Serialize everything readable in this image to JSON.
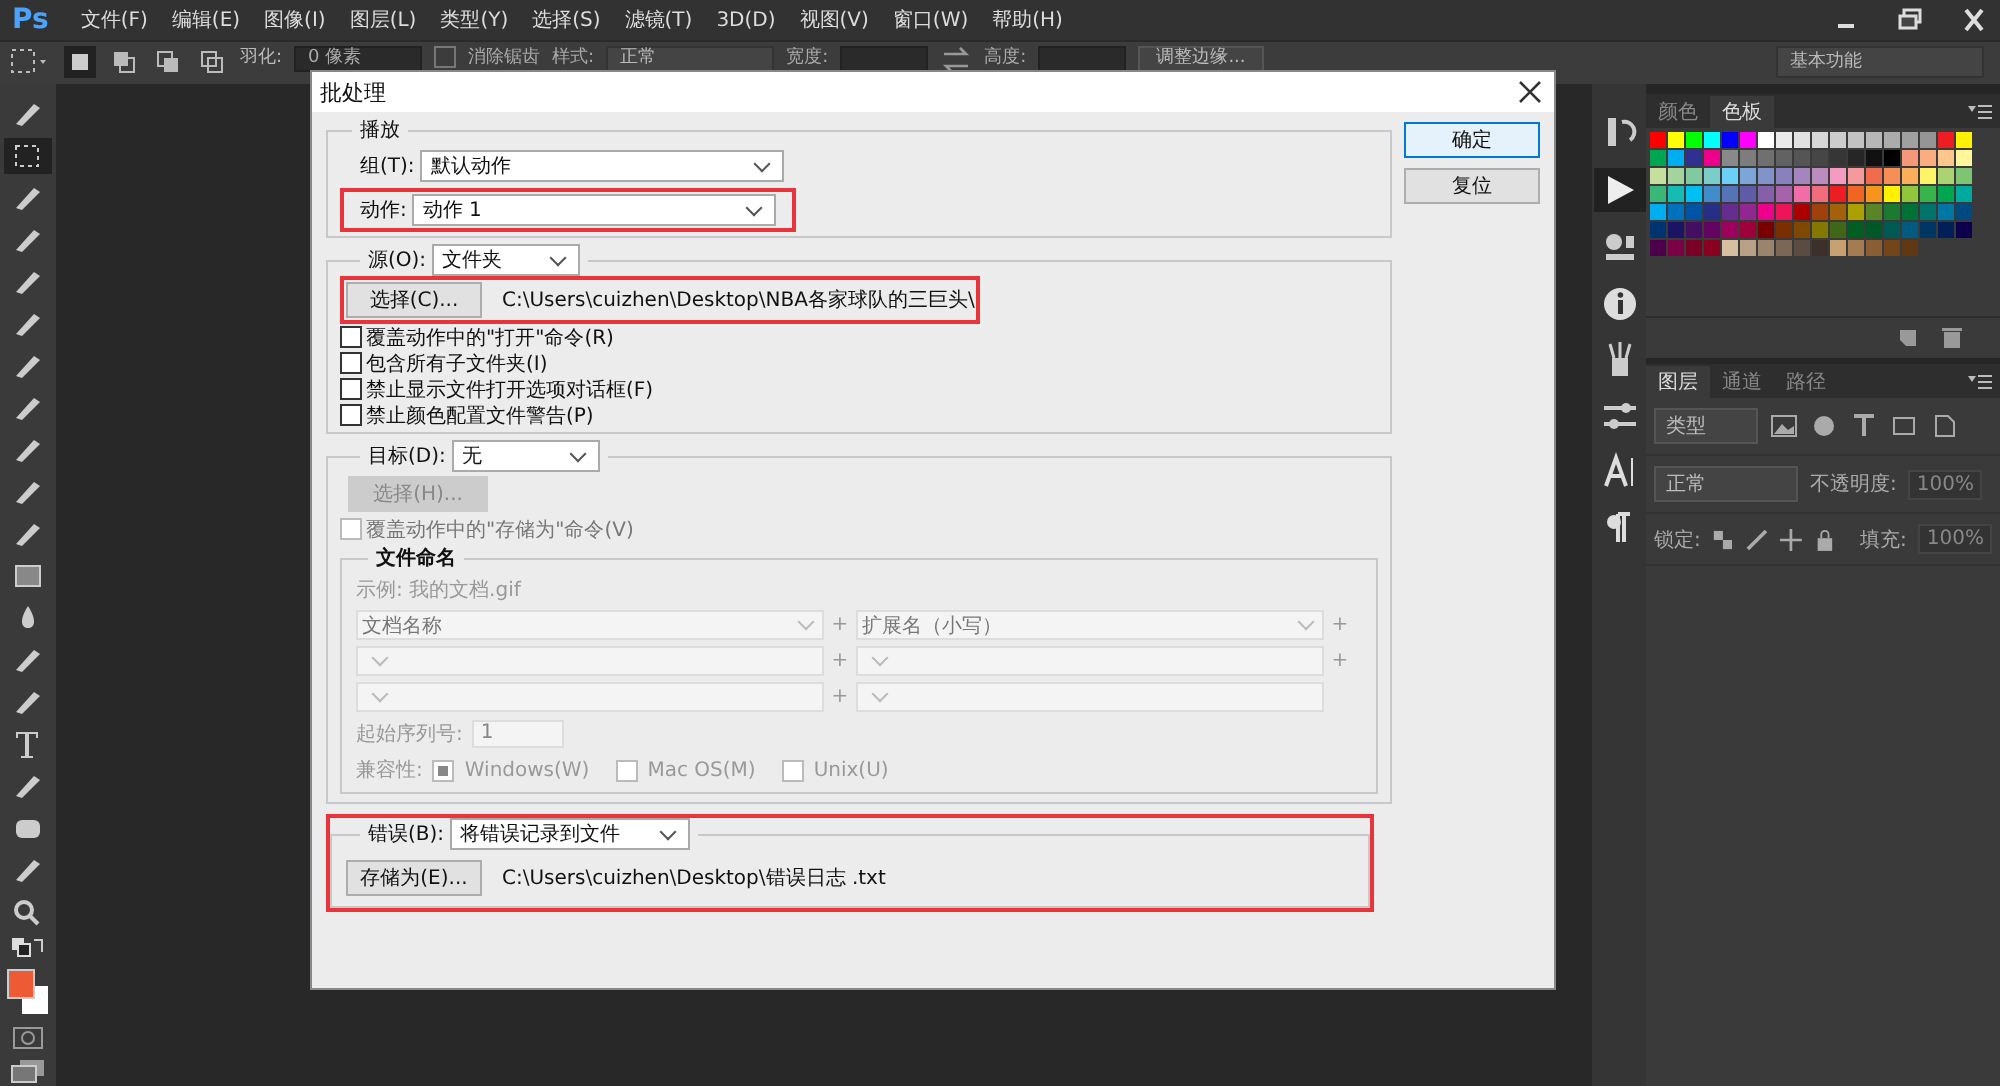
{
  "app": {
    "logo": "Ps",
    "menus": [
      "文件(F)",
      "编辑(E)",
      "图像(I)",
      "图层(L)",
      "类型(Y)",
      "选择(S)",
      "滤镜(T)",
      "3D(D)",
      "视图(V)",
      "窗口(W)",
      "帮助(H)"
    ]
  },
  "options_bar": {
    "feather_label": "羽化:",
    "feather_value": "0 像素",
    "antialias": {
      "label": "消除锯齿",
      "checked": false,
      "disabled": true
    },
    "style_label": "样式:",
    "style_value": "正常",
    "width_label": "宽度:",
    "height_label": "高度:",
    "refine_button": "调整边缘...",
    "workspace": "基本功能"
  },
  "dialog": {
    "title": "批处理",
    "buttons": [
      {
        "label": "确定",
        "default": true
      },
      {
        "label": "复位",
        "default": false
      }
    ],
    "play": {
      "legend": "播放",
      "group_label": "组(T):",
      "group_value": "默认动作",
      "action_label": "动作:",
      "action_value": "动作 1",
      "action_highlighted": true
    },
    "source": {
      "label": "源(O):",
      "value": "文件夹",
      "choose_button": "选择(C)...",
      "path": "C:\\Users\\cuizhen\\Desktop\\NBA各家球队的三巨头\\",
      "highlighted": true,
      "options": [
        {
          "label": "覆盖动作中的\"打开\"命令(R)",
          "checked": false
        },
        {
          "label": "包含所有子文件夹(I)",
          "checked": false
        },
        {
          "label": "禁止显示文件打开选项对话框(F)",
          "checked": false
        },
        {
          "label": "禁止颜色配置文件警告(P)",
          "checked": false
        }
      ]
    },
    "target": {
      "label": "目标(D):",
      "value": "无",
      "choose_button": "选择(H)...",
      "choose_disabled": true,
      "override": {
        "label": "覆盖动作中的\"存储为\"命令(V)",
        "checked": false,
        "disabled": true
      },
      "naming": {
        "legend": "文件命名",
        "disabled": true,
        "example": "示例: 我的文档.gif",
        "rows": [
          [
            {
              "value": "文档名称",
              "plus": "+"
            },
            {
              "value": "扩展名（小写）",
              "plus": "+"
            }
          ],
          [
            {
              "plus": "+"
            },
            {
              "plus": "+"
            }
          ],
          [
            {
              "plus": "+"
            },
            {}
          ]
        ],
        "serial_label": "起始序列号:",
        "serial_value": "1",
        "compat_label": "兼容性:",
        "compat": [
          {
            "label": "Windows(W)",
            "checked": true,
            "disabled": true
          },
          {
            "label": "Mac OS(M)",
            "checked": false,
            "disabled": true
          },
          {
            "label": "Unix(U)",
            "checked": false,
            "disabled": true
          }
        ]
      }
    },
    "errors": {
      "label": "错误(B):",
      "value": "将错误记录到文件",
      "save_button": "存储为(E)...",
      "path": "C:\\Users\\cuizhen\\Desktop\\错误日志 .txt",
      "highlighted": true
    }
  },
  "swatches_panel": {
    "tabs": [
      {
        "label": "颜色",
        "selected": false
      },
      {
        "label": "色板",
        "selected": true
      }
    ]
  },
  "layers_panel": {
    "tabs": [
      {
        "label": "图层",
        "selected": true
      },
      {
        "label": "通道",
        "selected": false
      },
      {
        "label": "路径",
        "selected": false
      }
    ],
    "filter": "类型",
    "blend": "正常",
    "opacity_label": "不透明度:",
    "opacity": "100%",
    "lock_label": "锁定:",
    "fill_label": "填充:",
    "fill": "100%"
  }
}
